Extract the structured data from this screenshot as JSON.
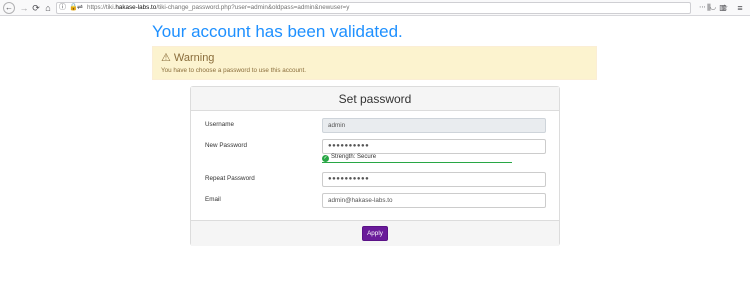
{
  "browser": {
    "back_icon": "←",
    "forward_icon": "→",
    "reload_icon": "⟳",
    "home_icon": "⌂",
    "info_icon": "ⓘ",
    "lock_icon": "🔒",
    "permissions_icon": "⇌",
    "url_prefix": "https://tiki.",
    "url_host": "hakase-labs.to",
    "url_path": "/tiki-change_password.php?user=admin&oldpass=admin&newuser=y",
    "more_icon": "⋯",
    "pocket_icon": "◡",
    "star_icon": "☆",
    "library_icon": "⫼",
    "sidebar_icon": "▥",
    "menu_icon": "≡"
  },
  "page": {
    "title": "Your account has been validated."
  },
  "warning": {
    "icon": "⚠",
    "title": "Warning",
    "message": "You have to choose a password to use this account."
  },
  "form": {
    "title": "Set password",
    "username_label": "Username",
    "username_value": "admin",
    "new_password_label": "New Password",
    "new_password_value": "●●●●●●●●●●",
    "strength_icon": "✓",
    "strength_text": "Strength: Secure",
    "strength_color": "#28a745",
    "repeat_password_label": "Repeat Password",
    "repeat_password_value": "●●●●●●●●●●",
    "email_label": "Email",
    "email_value": "admin@hakase-labs.to",
    "apply_label": "Apply",
    "apply_color": "#6a1b9a"
  },
  "colors": {
    "title": "#1e90ff",
    "warning_bg": "#fcf3cf",
    "warning_text": "#8a6d3b"
  }
}
